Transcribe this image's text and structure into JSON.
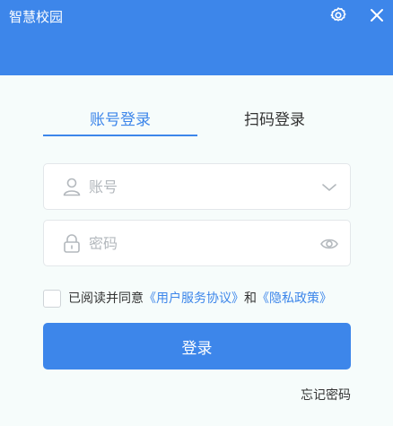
{
  "window": {
    "title": "智慧校园",
    "settings_icon": "gear-icon",
    "close_icon": "close-icon"
  },
  "tabs": [
    {
      "label": "账号登录",
      "active": true
    },
    {
      "label": "扫码登录",
      "active": false
    }
  ],
  "form": {
    "account": {
      "value": "",
      "placeholder": "账号",
      "icon": "user-icon",
      "right_icon": "chevron-down-icon"
    },
    "password": {
      "value": "",
      "placeholder": "密码",
      "icon": "lock-icon",
      "right_icon": "eye-icon"
    }
  },
  "agreement": {
    "checked": false,
    "prefix": "已阅读并同意",
    "terms": "《用户服务协议》",
    "conjunction": "和",
    "privacy": "《隐私政策》"
  },
  "actions": {
    "login_label": "登录",
    "forgot_label": "忘记密码"
  },
  "colors": {
    "accent": "#3d86ea",
    "background": "#f6fcfb",
    "text": "#333333",
    "placeholder": "#b3b8bd",
    "border": "#e3e7ea"
  }
}
